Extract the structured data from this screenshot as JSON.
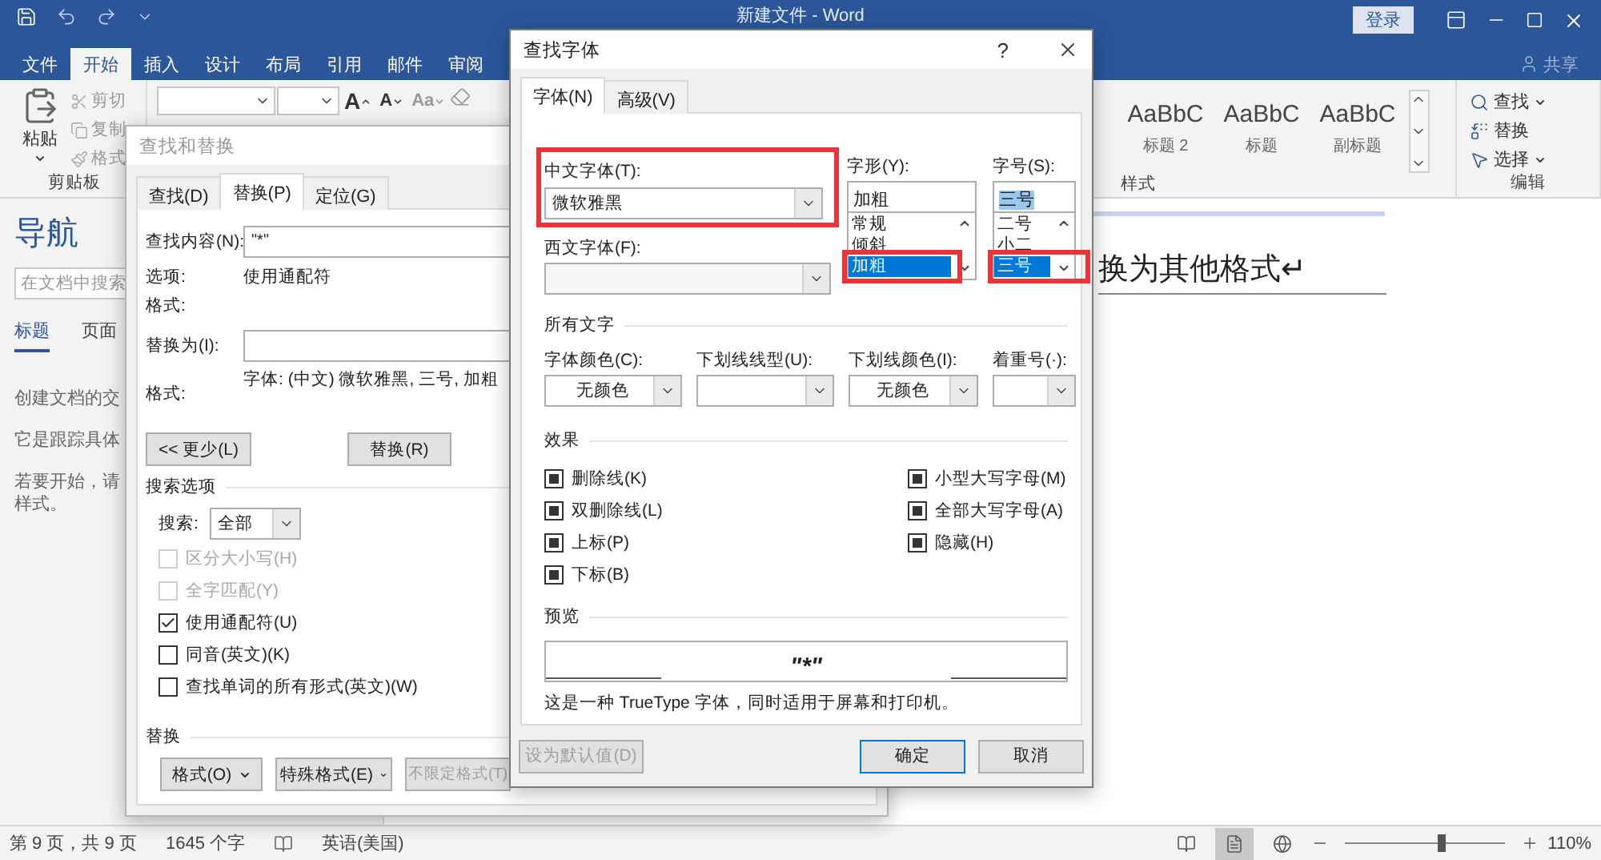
{
  "titlebar": {
    "title": "新建文件 - Word",
    "signin": "登录"
  },
  "ribbon_tabs": [
    {
      "label": "文件",
      "selected": false
    },
    {
      "label": "开始",
      "selected": true
    },
    {
      "label": "插入",
      "selected": false
    },
    {
      "label": "设计",
      "selected": false
    },
    {
      "label": "布局",
      "selected": false
    },
    {
      "label": "引用",
      "selected": false
    },
    {
      "label": "邮件",
      "selected": false
    },
    {
      "label": "审阅",
      "selected": false
    }
  ],
  "share": "共享",
  "clipboard": {
    "paste": "粘贴",
    "items": [
      {
        "label": "剪切",
        "kind": "cut"
      },
      {
        "label": "复制",
        "kind": "copy"
      },
      {
        "label": "格式",
        "kind": "painter"
      }
    ],
    "group": "剪贴板"
  },
  "font_buttons": [
    {
      "label": "A",
      "kind": "grow"
    },
    {
      "label": "A",
      "kind": "shrink"
    },
    {
      "label": "Aa",
      "kind": "case"
    }
  ],
  "styles": {
    "items": [
      {
        "sample": "AaBbC",
        "label": "标题 2"
      },
      {
        "sample": "AaBbC",
        "label": "标题"
      },
      {
        "sample": "AaBbC",
        "label": "副标题"
      }
    ],
    "group": "样式"
  },
  "editing": {
    "items": [
      {
        "label": "查找",
        "kind": "find",
        "menu": true
      },
      {
        "label": "替换",
        "kind": "replace",
        "menu": false
      },
      {
        "label": "选择",
        "kind": "select",
        "menu": true
      }
    ],
    "group": "编辑"
  },
  "navigation": {
    "title": "导航",
    "search": {
      "placeholder": "在文档中搜索"
    },
    "tabs": [
      {
        "label": "标题",
        "selected": true
      },
      {
        "label": "页面",
        "selected": false
      }
    ],
    "paragraphs": [
      [
        "创建文档的交"
      ],
      [
        "它是跟踪具体"
      ],
      [
        "若要开始，请",
        "样式。"
      ]
    ]
  },
  "document": {
    "heading": "换为其他格式↵"
  },
  "status_bar": {
    "page": "第 9 页，共 9 页",
    "words": "1645 个字",
    "language": "英语(美国)",
    "views": [
      {
        "kind": "read",
        "selected": false
      },
      {
        "kind": "print",
        "selected": true
      },
      {
        "kind": "web",
        "selected": false
      }
    ],
    "zoom_slider": {
      "level": 0.6
    },
    "zoom": "110%"
  },
  "find_replace": {
    "title": "查找和替换",
    "tabs": [
      {
        "label": "查找(D)",
        "selected": false
      },
      {
        "label": "替换(P)",
        "selected": true
      },
      {
        "label": "定位(G)",
        "selected": false
      }
    ],
    "find_label": "查找内容(N):",
    "find_value": "\"*\"",
    "options_label": "选项:",
    "options_value": "使用通配符",
    "find_format_label": "格式:",
    "replace_label": "替换为(I):",
    "replace_format_label": "格式:",
    "replace_format_value": "字体: (中文) 微软雅黑, 三号, 加粗",
    "buttons": [
      {
        "label": "<< 更少(L)"
      },
      {
        "label": "替换(R)"
      }
    ],
    "search_options_title": "搜索选项",
    "search_label": "搜索:",
    "search_value": "全部",
    "checkboxes": [
      {
        "label": "区分大小写(H)",
        "checked": false,
        "disabled": true
      },
      {
        "label": "全字匹配(Y)",
        "checked": false,
        "disabled": true
      },
      {
        "label": "使用通配符(U)",
        "checked": true,
        "disabled": false
      },
      {
        "label": "同音(英文)(K)",
        "checked": false,
        "disabled": false
      },
      {
        "label": "查找单词的所有形式(英文)(W)",
        "checked": false,
        "disabled": false
      }
    ],
    "replace_section": "替换",
    "bottom_buttons": [
      {
        "label": "格式(O)",
        "menu": true,
        "disabled": false
      },
      {
        "label": "特殊格式(E)",
        "menu": true,
        "disabled": false
      },
      {
        "label": "不限定格式(T)",
        "menu": false,
        "disabled": true
      }
    ]
  },
  "find_font": {
    "title": "查找字体",
    "help": "?",
    "tabs": [
      {
        "label": "字体(N)",
        "selected": true
      },
      {
        "label": "高级(V)",
        "selected": false
      }
    ],
    "chinese_font": {
      "label": "中文字体(T):",
      "value": "微软雅黑",
      "highlighted": true
    },
    "western_font": {
      "label": "西文字体(F):"
    },
    "style": {
      "label": "字形(Y):",
      "value": "加粗",
      "value_selected": false,
      "highlighted": true,
      "options": [
        {
          "label": "常规",
          "selected": false
        },
        {
          "label": "倾斜",
          "selected": false
        },
        {
          "label": "加粗",
          "selected": true
        }
      ]
    },
    "size": {
      "label": "字号(S):",
      "value": "三号",
      "value_selected": true,
      "highlighted": true,
      "options": [
        {
          "label": "二号",
          "selected": false
        },
        {
          "label": "小二",
          "selected": false
        },
        {
          "label": "三号",
          "selected": true
        }
      ]
    },
    "all_text_title": "所有文字",
    "all_text": [
      {
        "label": "字体颜色(C):",
        "value": "无颜色"
      },
      {
        "label": "下划线线型(U):"
      },
      {
        "label": "下划线颜色(I):",
        "value": "无颜色"
      },
      {
        "label": "着重号(·):"
      }
    ],
    "effects_title": "效果",
    "effects_left": [
      {
        "label": "删除线(K)",
        "indeterminate": true
      },
      {
        "label": "双删除线(L)",
        "indeterminate": true
      },
      {
        "label": "上标(P)",
        "indeterminate": true
      },
      {
        "label": "下标(B)",
        "indeterminate": true
      }
    ],
    "effects_right": [
      {
        "label": "小型大写字母(M)",
        "indeterminate": true
      },
      {
        "label": "全部大写字母(A)",
        "indeterminate": true
      },
      {
        "label": "隐藏(H)",
        "indeterminate": true
      }
    ],
    "preview_title": "预览",
    "preview_text": "\"*\"",
    "note": "这是一种 TrueType 字体，同时适用于屏幕和打印机。",
    "buttons": [
      {
        "label": "设为默认值(D)",
        "disabled": true,
        "default": false
      },
      {
        "label": "确定",
        "disabled": false,
        "default": true
      },
      {
        "label": "取消",
        "disabled": false,
        "default": false
      }
    ]
  }
}
